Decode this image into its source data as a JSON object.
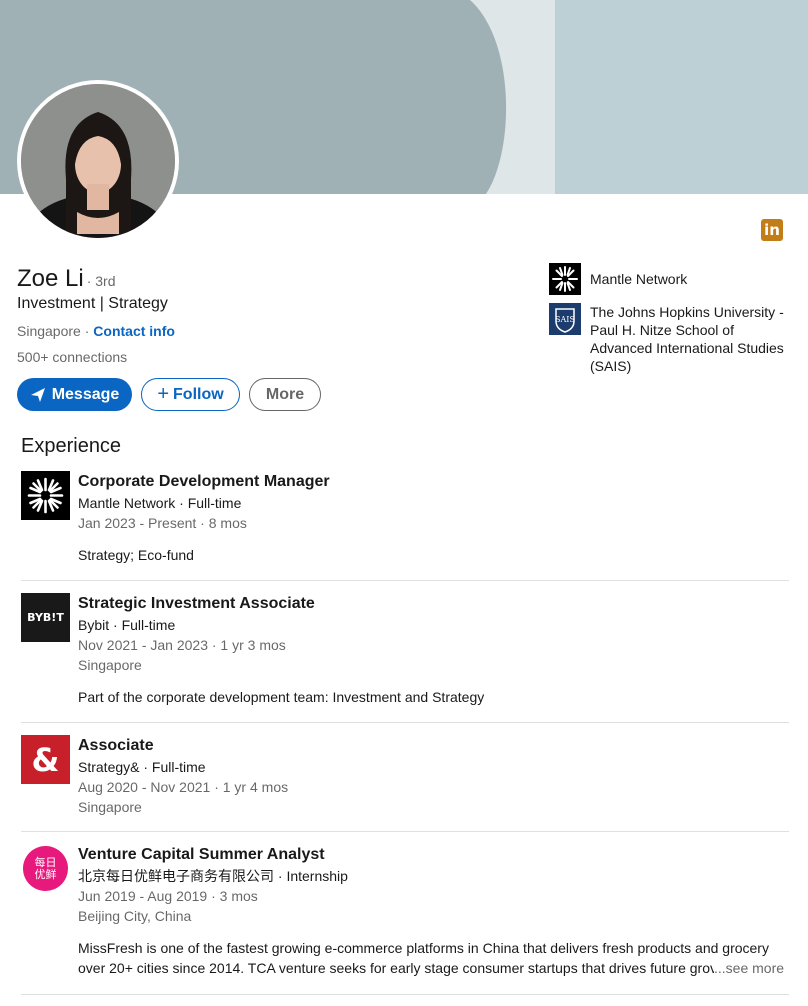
{
  "profile": {
    "name": "Zoe Li",
    "degree": "· 3rd",
    "headline": "Investment | Strategy",
    "location": "Singapore · ",
    "contact_label": "Contact info",
    "connections": "500+ connections"
  },
  "actions": {
    "message_label": "Message",
    "follow_label": "Follow",
    "more_label": "More"
  },
  "sidebar": {
    "items": [
      {
        "label": "Mantle Network",
        "icon": "mantle-logo-icon"
      },
      {
        "label": "The Johns Hopkins University - Paul H. Nitze School of Advanced International Studies (SAIS)",
        "icon": "sais-logo-icon"
      }
    ]
  },
  "experience": {
    "heading": "Experience",
    "jobs": [
      {
        "title": "Corporate Development Manager",
        "company": "Mantle Network · Full-time",
        "dates": "Jan 2023 - Present · 8 mos",
        "location": "",
        "description": "Strategy; Eco-fund"
      },
      {
        "title": "Strategic Investment Associate",
        "company": "Bybit · Full-time",
        "dates": "Nov 2021 - Jan 2023 · 1 yr 3 mos",
        "location": "Singapore",
        "description": "Part of the corporate development team: Investment and Strategy",
        "logo_text": "BYB!T"
      },
      {
        "title": "Associate",
        "company": "Strategy& · Full-time",
        "dates": "Aug 2020 - Nov 2021 · 1 yr 4 mos",
        "location": "Singapore",
        "logo_text": "&"
      },
      {
        "title": "Venture Capital Summer Analyst",
        "company": "北京每日优鲜电子商务有限公司 · Internship",
        "dates": "Jun 2019 - Aug 2019 · 3 mos",
        "location": "Beijing City, China",
        "description_line1": "MissFresh is one of the fastest growing e-commerce platforms in China that delivers fresh products and grocery",
        "description_line2": "over 20+ cities since 2014. TCA venture seeks for early stage consumer startups that drives future grov",
        "see_more": "...see more",
        "logo_text_1": "每日",
        "logo_text_2": "优鲜"
      }
    ]
  },
  "colors": {
    "primary": "#0a66c2",
    "linkedin_badge": "#c37d16",
    "strategy_red": "#c8202b",
    "missfresh_pink": "#e8197d"
  }
}
